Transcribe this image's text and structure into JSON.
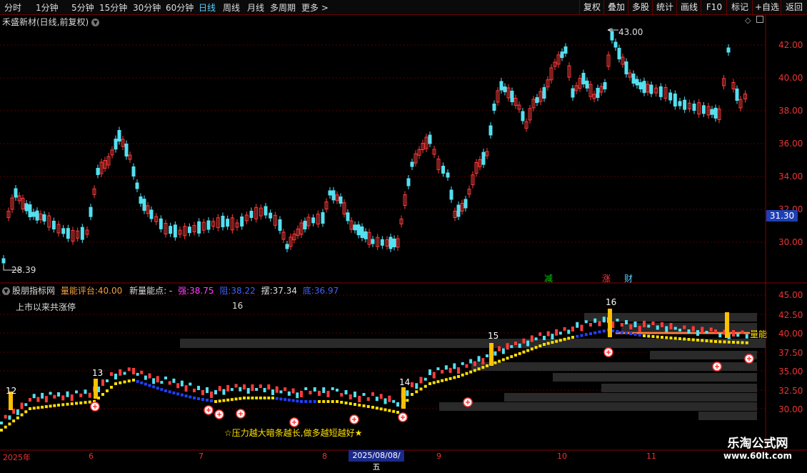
{
  "toolbar": {
    "periods": [
      "分时",
      "1分钟",
      "5分钟",
      "15分钟",
      "30分钟",
      "60分钟",
      "日线",
      "周线",
      "月线",
      "多周期",
      "更多 >"
    ],
    "active_period": "日线",
    "buttons": [
      "复权",
      "叠加",
      "多股",
      "统计",
      "画线",
      "F10",
      "标记",
      "+自选",
      "返回"
    ]
  },
  "main_pane": {
    "title": "禾盛新材(日线,前复权)",
    "price_axis": [
      "42.00",
      "40.00",
      "38.00",
      "36.00",
      "34.00",
      "32.00",
      "30.00"
    ],
    "current_price": "31.30",
    "max_label": "43.00",
    "min_label": "28.39",
    "event_markers": [
      "减",
      "涨",
      "财"
    ]
  },
  "sub_pane": {
    "indicator_name": "股朋指标网",
    "score_label": "量能评台:",
    "score_value": "40.00",
    "point_label": "新量能点: -",
    "strong_label": "强:",
    "strong_value": "38.75",
    "resist_label": "阻:",
    "resist_value": "38.22",
    "swing_label": "摆:",
    "swing_value": "37.34",
    "bottom_label": "底:",
    "bottom_value": "36.97",
    "limit_up_text": "上市以来共涨停",
    "limit_up_count": "16",
    "axis": [
      "45.00",
      "42.50",
      "40.00",
      "37.50",
      "35.00",
      "32.50",
      "30.00"
    ],
    "side_label": "量能",
    "bottom_note": "☆压力越大暗条越长,做多越短越好★",
    "counters": [
      "12",
      "13",
      "14",
      "15",
      "16"
    ]
  },
  "dates": {
    "labels": [
      "2025年",
      "6",
      "7",
      "8",
      "9",
      "10",
      "11"
    ],
    "selected": "2025/08/08/五"
  },
  "watermark": {
    "title": "乐淘公式网",
    "url": "www.60lt.com"
  },
  "colors": {
    "up": "#ff3b3b",
    "down": "#54e0f0",
    "grid": "#7a0000",
    "accent": "#5ad1ff"
  }
}
